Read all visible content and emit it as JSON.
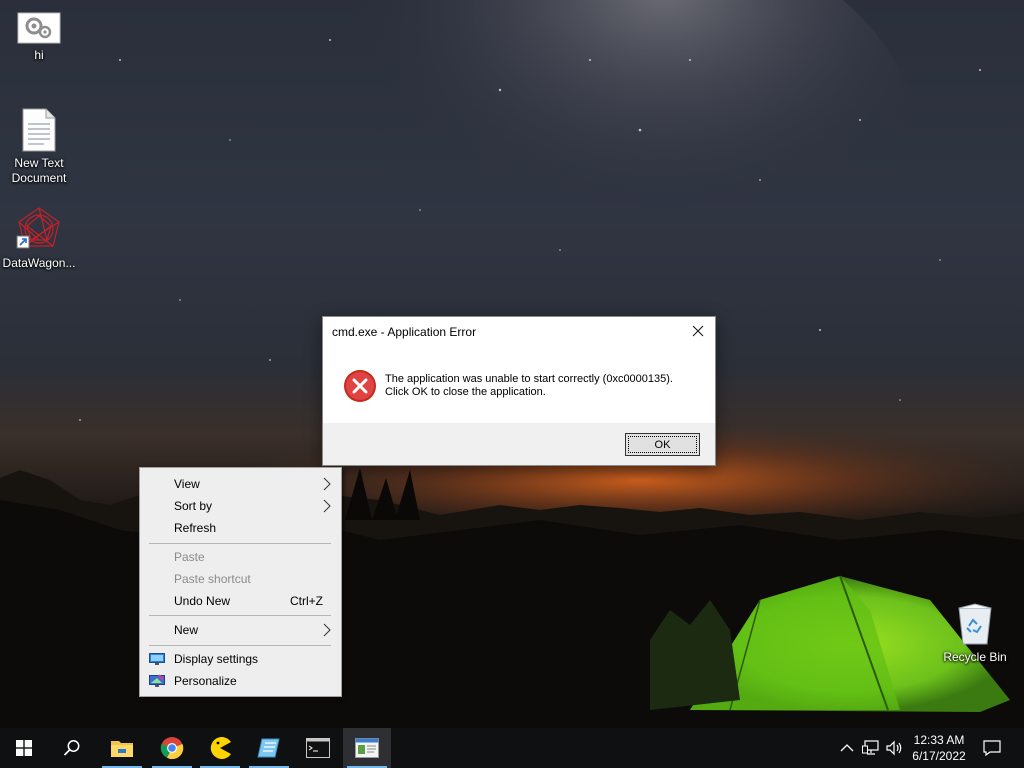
{
  "desktop": {
    "icons": [
      {
        "label": "hi",
        "icon": "settings-image-icon"
      },
      {
        "label": "New Text Document",
        "icon": "text-document-icon"
      },
      {
        "label": "DataWagon...",
        "icon": "datawagon-shortcut-icon"
      },
      {
        "label": "Recycle Bin",
        "icon": "recycle-bin-icon"
      }
    ]
  },
  "dialog": {
    "title": "cmd.exe - Application Error",
    "message_line1": "The application was unable to start correctly (0xc0000135).",
    "message_line2": "Click OK to close the application.",
    "ok_label": "OK",
    "icon": "error-icon"
  },
  "context_menu": {
    "items": [
      {
        "label": "View",
        "submenu": true,
        "enabled": true
      },
      {
        "label": "Sort by",
        "submenu": true,
        "enabled": true
      },
      {
        "label": "Refresh",
        "enabled": true
      },
      {
        "label": "Paste",
        "enabled": false
      },
      {
        "label": "Paste shortcut",
        "enabled": false
      },
      {
        "label": "Undo New",
        "shortcut": "Ctrl+Z",
        "enabled": true
      },
      {
        "label": "New",
        "submenu": true,
        "enabled": true
      },
      {
        "label": "Display settings",
        "icon": "display-settings-icon",
        "enabled": true
      },
      {
        "label": "Personalize",
        "icon": "personalize-icon",
        "enabled": true
      }
    ]
  },
  "taskbar": {
    "apps": [
      {
        "name": "file-explorer",
        "icon": "folder-icon",
        "running": true
      },
      {
        "name": "chrome",
        "icon": "chrome-icon",
        "running": true
      },
      {
        "name": "pac-man",
        "icon": "pacman-icon",
        "running": true
      },
      {
        "name": "notepad-like",
        "icon": "app-icon",
        "running": true
      },
      {
        "name": "command-prompt",
        "icon": "cmd-icon",
        "running": false
      },
      {
        "name": "active-window",
        "icon": "window-icon",
        "running": true,
        "active": true
      }
    ],
    "clock_time": "12:33 AM",
    "clock_date": "6/17/2022",
    "accent": "#76b9ed"
  }
}
